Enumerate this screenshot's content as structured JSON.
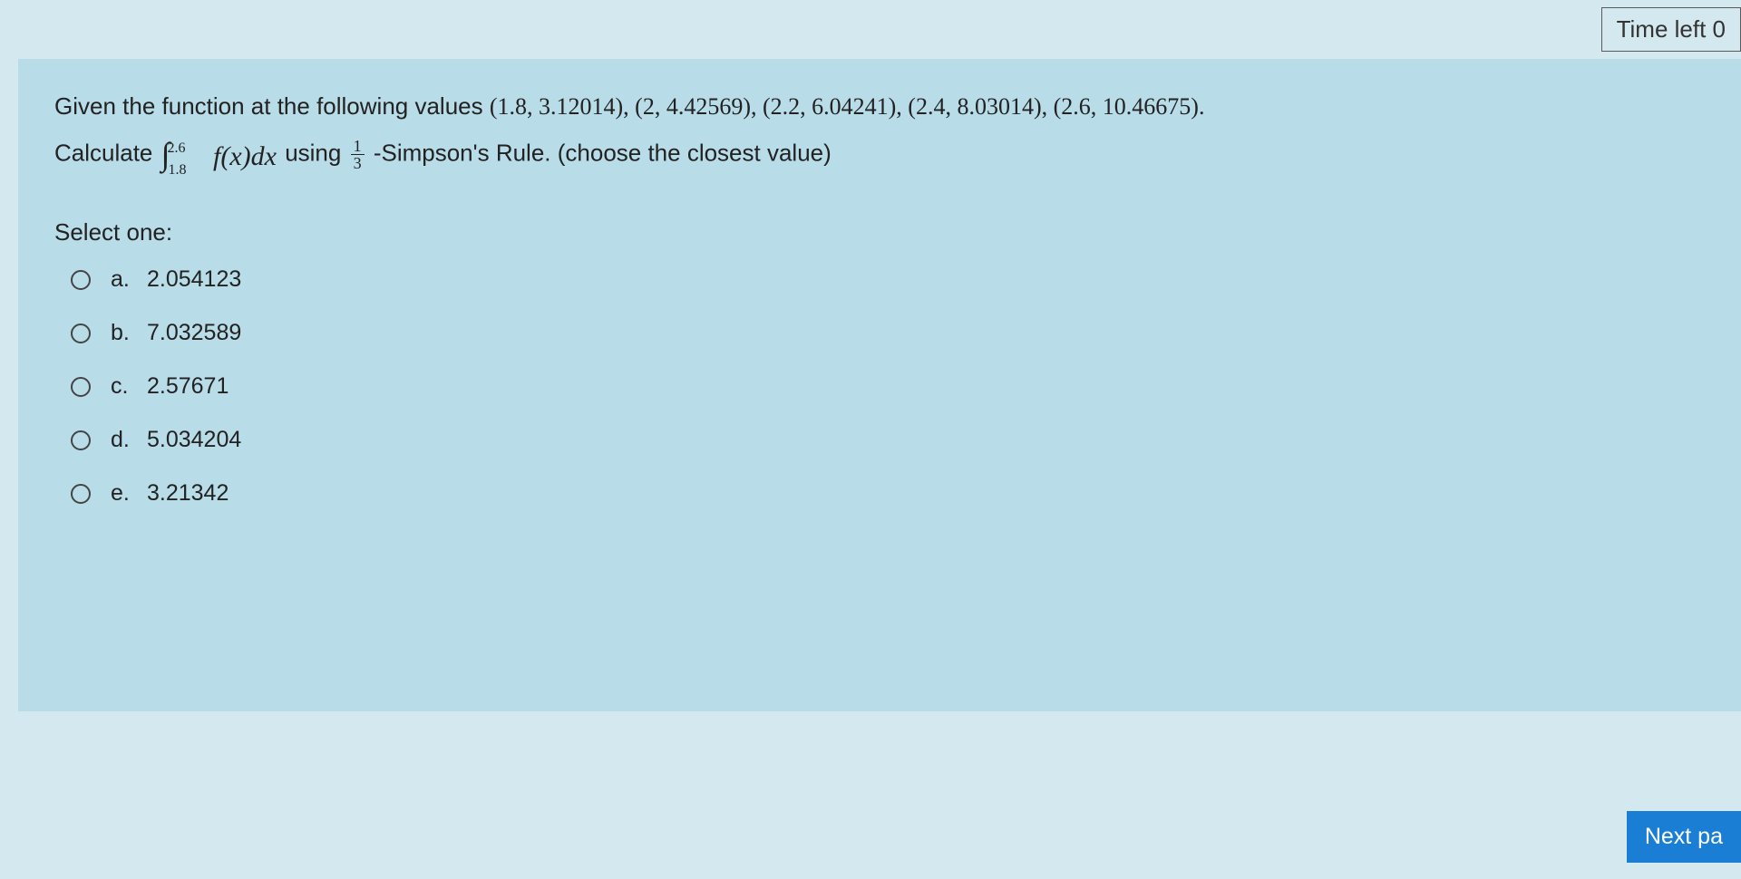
{
  "timer": {
    "label": "Time left 0"
  },
  "question": {
    "intro": "Given the function at the following values ",
    "points": "(1.8, 3.12014), (2, 4.42569), (2.2, 6.04241), (2.4, 8.03014), (2.6, 10.46675).",
    "calc_prefix": "Calculate ",
    "integral_upper": "2.6",
    "integral_lower": "1.8",
    "integrand": "f(x)dx",
    "using": " using ",
    "frac_num": "1",
    "frac_den": "3",
    "rule_suffix": "-Simpson's Rule. (choose the closest value)"
  },
  "select_label": "Select one:",
  "options": [
    {
      "letter": "a.",
      "value": "2.054123"
    },
    {
      "letter": "b.",
      "value": "7.032589"
    },
    {
      "letter": "c.",
      "value": "2.57671"
    },
    {
      "letter": "d.",
      "value": "5.034204"
    },
    {
      "letter": "e.",
      "value": "3.21342"
    }
  ],
  "next_button": "Next pa"
}
